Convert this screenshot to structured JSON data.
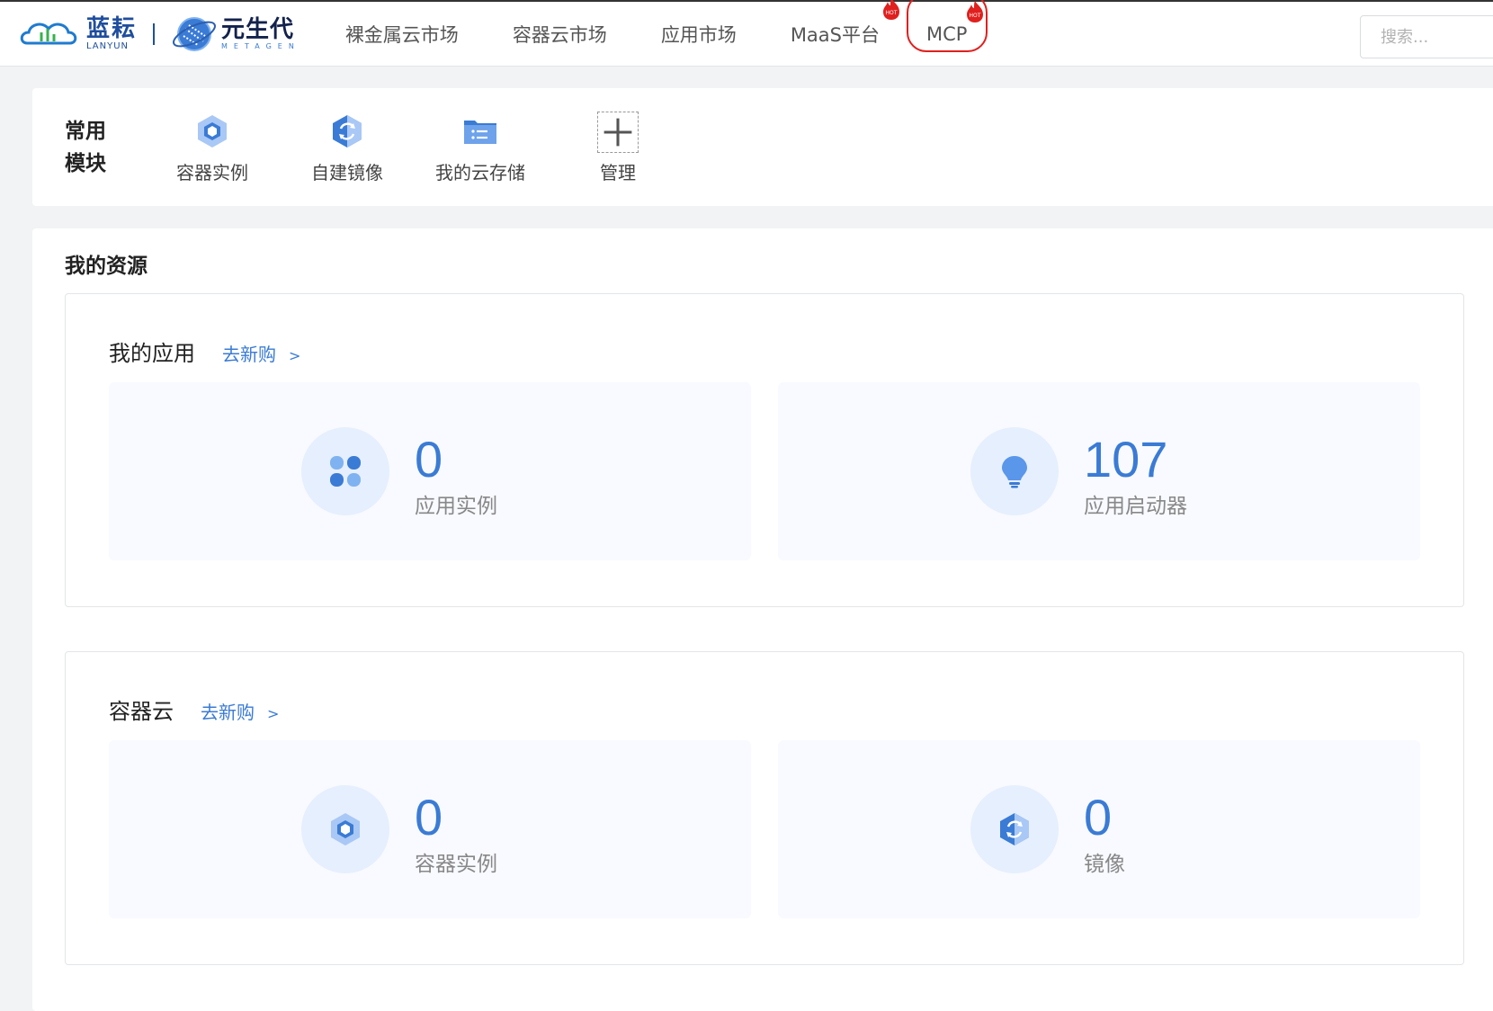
{
  "brand": {
    "lanyun_cn": "蓝耘",
    "lanyun_en": "LANYUN",
    "metagen_cn": "元生代",
    "metagen_en": "METAGEN"
  },
  "nav": {
    "items": [
      {
        "label": "裸金属云市场"
      },
      {
        "label": "容器云市场"
      },
      {
        "label": "应用市场"
      },
      {
        "label": "MaaS平台",
        "badge": "HOT"
      },
      {
        "label": "MCP",
        "badge": "HOT"
      }
    ]
  },
  "search": {
    "placeholder": "搜索..."
  },
  "modules": {
    "title": "常用模块",
    "items": [
      {
        "label": "容器实例",
        "icon": "cube-icon"
      },
      {
        "label": "自建镜像",
        "icon": "image-sync-icon"
      },
      {
        "label": "我的云存储",
        "icon": "folder-icon"
      },
      {
        "label": "管理",
        "icon": "plus-icon"
      }
    ]
  },
  "resources": {
    "title": "我的资源",
    "apps": {
      "title": "我的应用",
      "link": "去新购",
      "link_arrow": ">",
      "stats": [
        {
          "value": "0",
          "label": "应用实例",
          "icon": "grid-icon"
        },
        {
          "value": "107",
          "label": "应用启动器",
          "icon": "lightbulb-icon"
        }
      ]
    },
    "container": {
      "title": "容器云",
      "link": "去新购",
      "link_arrow": ">",
      "stats": [
        {
          "value": "0",
          "label": "容器实例",
          "icon": "cube-icon"
        },
        {
          "value": "0",
          "label": "镜像",
          "icon": "image-sync-icon"
        }
      ]
    }
  },
  "colors": {
    "accent": "#3a7bd5",
    "hot": "#e0201e"
  }
}
